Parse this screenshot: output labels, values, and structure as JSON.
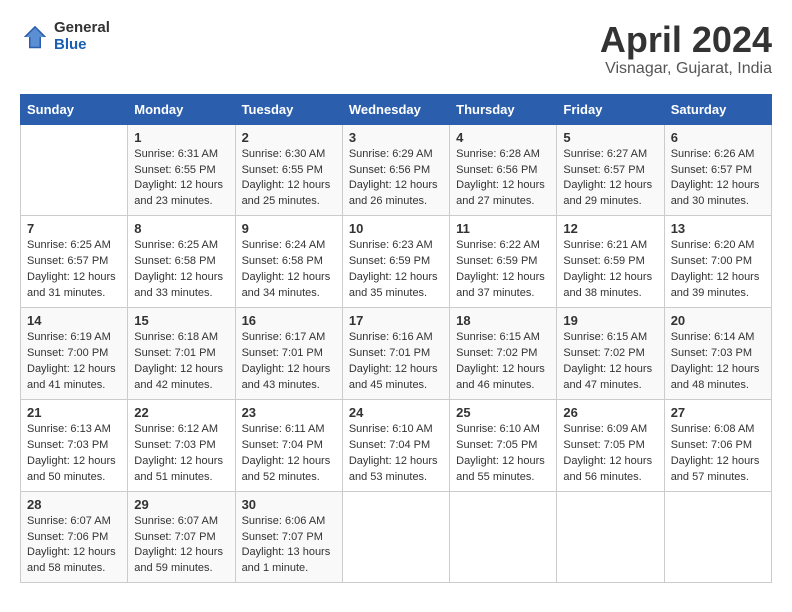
{
  "header": {
    "logo_general": "General",
    "logo_blue": "Blue",
    "title": "April 2024",
    "location": "Visnagar, Gujarat, India"
  },
  "days_of_week": [
    "Sunday",
    "Monday",
    "Tuesday",
    "Wednesday",
    "Thursday",
    "Friday",
    "Saturday"
  ],
  "weeks": [
    [
      {
        "day": "",
        "content": ""
      },
      {
        "day": "1",
        "content": "Sunrise: 6:31 AM\nSunset: 6:55 PM\nDaylight: 12 hours\nand 23 minutes."
      },
      {
        "day": "2",
        "content": "Sunrise: 6:30 AM\nSunset: 6:55 PM\nDaylight: 12 hours\nand 25 minutes."
      },
      {
        "day": "3",
        "content": "Sunrise: 6:29 AM\nSunset: 6:56 PM\nDaylight: 12 hours\nand 26 minutes."
      },
      {
        "day": "4",
        "content": "Sunrise: 6:28 AM\nSunset: 6:56 PM\nDaylight: 12 hours\nand 27 minutes."
      },
      {
        "day": "5",
        "content": "Sunrise: 6:27 AM\nSunset: 6:57 PM\nDaylight: 12 hours\nand 29 minutes."
      },
      {
        "day": "6",
        "content": "Sunrise: 6:26 AM\nSunset: 6:57 PM\nDaylight: 12 hours\nand 30 minutes."
      }
    ],
    [
      {
        "day": "7",
        "content": "Sunrise: 6:25 AM\nSunset: 6:57 PM\nDaylight: 12 hours\nand 31 minutes."
      },
      {
        "day": "8",
        "content": "Sunrise: 6:25 AM\nSunset: 6:58 PM\nDaylight: 12 hours\nand 33 minutes."
      },
      {
        "day": "9",
        "content": "Sunrise: 6:24 AM\nSunset: 6:58 PM\nDaylight: 12 hours\nand 34 minutes."
      },
      {
        "day": "10",
        "content": "Sunrise: 6:23 AM\nSunset: 6:59 PM\nDaylight: 12 hours\nand 35 minutes."
      },
      {
        "day": "11",
        "content": "Sunrise: 6:22 AM\nSunset: 6:59 PM\nDaylight: 12 hours\nand 37 minutes."
      },
      {
        "day": "12",
        "content": "Sunrise: 6:21 AM\nSunset: 6:59 PM\nDaylight: 12 hours\nand 38 minutes."
      },
      {
        "day": "13",
        "content": "Sunrise: 6:20 AM\nSunset: 7:00 PM\nDaylight: 12 hours\nand 39 minutes."
      }
    ],
    [
      {
        "day": "14",
        "content": "Sunrise: 6:19 AM\nSunset: 7:00 PM\nDaylight: 12 hours\nand 41 minutes."
      },
      {
        "day": "15",
        "content": "Sunrise: 6:18 AM\nSunset: 7:01 PM\nDaylight: 12 hours\nand 42 minutes."
      },
      {
        "day": "16",
        "content": "Sunrise: 6:17 AM\nSunset: 7:01 PM\nDaylight: 12 hours\nand 43 minutes."
      },
      {
        "day": "17",
        "content": "Sunrise: 6:16 AM\nSunset: 7:01 PM\nDaylight: 12 hours\nand 45 minutes."
      },
      {
        "day": "18",
        "content": "Sunrise: 6:15 AM\nSunset: 7:02 PM\nDaylight: 12 hours\nand 46 minutes."
      },
      {
        "day": "19",
        "content": "Sunrise: 6:15 AM\nSunset: 7:02 PM\nDaylight: 12 hours\nand 47 minutes."
      },
      {
        "day": "20",
        "content": "Sunrise: 6:14 AM\nSunset: 7:03 PM\nDaylight: 12 hours\nand 48 minutes."
      }
    ],
    [
      {
        "day": "21",
        "content": "Sunrise: 6:13 AM\nSunset: 7:03 PM\nDaylight: 12 hours\nand 50 minutes."
      },
      {
        "day": "22",
        "content": "Sunrise: 6:12 AM\nSunset: 7:03 PM\nDaylight: 12 hours\nand 51 minutes."
      },
      {
        "day": "23",
        "content": "Sunrise: 6:11 AM\nSunset: 7:04 PM\nDaylight: 12 hours\nand 52 minutes."
      },
      {
        "day": "24",
        "content": "Sunrise: 6:10 AM\nSunset: 7:04 PM\nDaylight: 12 hours\nand 53 minutes."
      },
      {
        "day": "25",
        "content": "Sunrise: 6:10 AM\nSunset: 7:05 PM\nDaylight: 12 hours\nand 55 minutes."
      },
      {
        "day": "26",
        "content": "Sunrise: 6:09 AM\nSunset: 7:05 PM\nDaylight: 12 hours\nand 56 minutes."
      },
      {
        "day": "27",
        "content": "Sunrise: 6:08 AM\nSunset: 7:06 PM\nDaylight: 12 hours\nand 57 minutes."
      }
    ],
    [
      {
        "day": "28",
        "content": "Sunrise: 6:07 AM\nSunset: 7:06 PM\nDaylight: 12 hours\nand 58 minutes."
      },
      {
        "day": "29",
        "content": "Sunrise: 6:07 AM\nSunset: 7:07 PM\nDaylight: 12 hours\nand 59 minutes."
      },
      {
        "day": "30",
        "content": "Sunrise: 6:06 AM\nSunset: 7:07 PM\nDaylight: 13 hours\nand 1 minute."
      },
      {
        "day": "",
        "content": ""
      },
      {
        "day": "",
        "content": ""
      },
      {
        "day": "",
        "content": ""
      },
      {
        "day": "",
        "content": ""
      }
    ]
  ]
}
